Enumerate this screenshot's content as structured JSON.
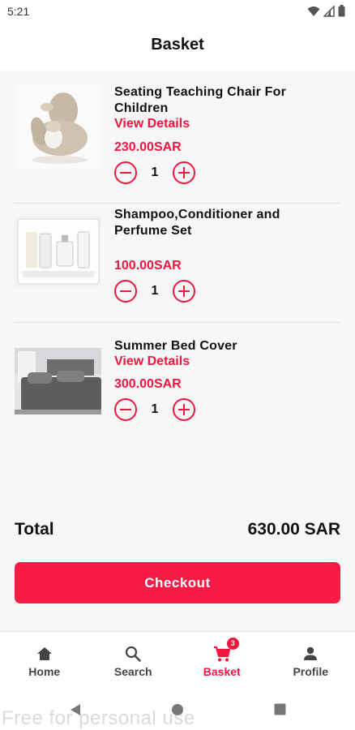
{
  "status_bar": {
    "time": "5:21"
  },
  "header": {
    "title": "Basket"
  },
  "items": [
    {
      "name": "Seating Teaching Chair For Children",
      "view_details": "View Details",
      "price": "230.00SAR",
      "quantity": "1"
    },
    {
      "name": "Shampoo,Conditioner and Perfume Set",
      "price": "100.00SAR",
      "quantity": "1"
    },
    {
      "name": "Summer Bed Cover",
      "view_details": "View Details",
      "price": "300.00SAR",
      "quantity": "1"
    }
  ],
  "summary": {
    "total_label": "Total",
    "total_value": "630.00 SAR"
  },
  "checkout_label": "Checkout",
  "bottom_nav": {
    "items": [
      {
        "label": "Home",
        "icon": "home-icon"
      },
      {
        "label": "Search",
        "icon": "search-icon"
      },
      {
        "label": "Basket",
        "icon": "cart-icon",
        "badge": "3",
        "active": true
      },
      {
        "label": "Profile",
        "icon": "person-icon"
      }
    ]
  },
  "watermark": "Free for personal use",
  "colors": {
    "accent": "#f0163e",
    "checkout": "#f81b46",
    "background": "#f7f7f7"
  }
}
